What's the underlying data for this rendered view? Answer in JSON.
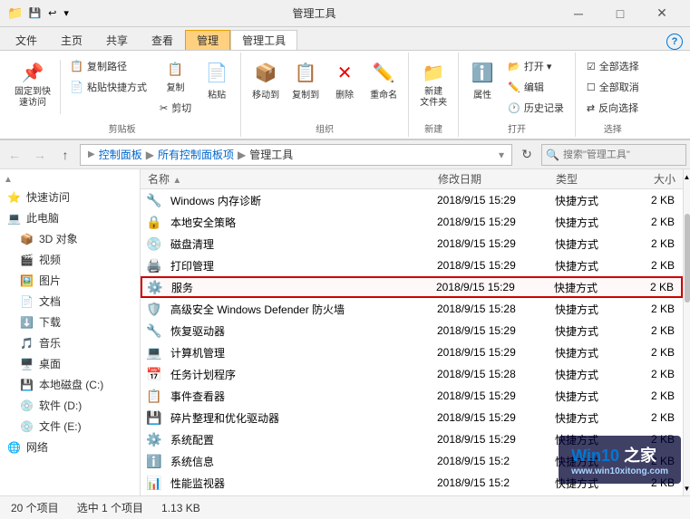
{
  "titlebar": {
    "title": "管理工具",
    "icon": "📁",
    "min_label": "─",
    "max_label": "□",
    "close_label": "✕"
  },
  "ribbon_tabs": [
    {
      "id": "file",
      "label": "文件"
    },
    {
      "id": "home",
      "label": "主页"
    },
    {
      "id": "share",
      "label": "共享"
    },
    {
      "id": "view",
      "label": "查看"
    },
    {
      "id": "manage",
      "label": "管理",
      "highlighted": true
    },
    {
      "id": "manage_tools",
      "label": "管理工具"
    }
  ],
  "ribbon": {
    "groups": [
      {
        "id": "clipboard",
        "label": "剪贴板",
        "buttons": [
          {
            "id": "pin",
            "icon": "📌",
            "label": "固定到快\n速访问"
          },
          {
            "id": "copy",
            "icon": "📋",
            "label": "复制"
          },
          {
            "id": "paste",
            "icon": "📄",
            "label": "粘贴"
          }
        ],
        "sub_buttons": [
          {
            "id": "copy_path",
            "icon": "📋",
            "label": "复制路径"
          },
          {
            "id": "paste_shortcut",
            "icon": "📄",
            "label": "粘贴快捷方式"
          },
          {
            "id": "cut",
            "icon": "✂️",
            "label": "剪切"
          }
        ]
      },
      {
        "id": "organize",
        "label": "组织",
        "buttons": [
          {
            "id": "move_to",
            "icon": "📦",
            "label": "移动到"
          },
          {
            "id": "copy_to",
            "icon": "📋",
            "label": "复制到"
          },
          {
            "id": "delete",
            "icon": "❌",
            "label": "删除"
          },
          {
            "id": "rename",
            "icon": "✏️",
            "label": "重命名"
          }
        ]
      },
      {
        "id": "new",
        "label": "新建",
        "buttons": [
          {
            "id": "new_folder",
            "icon": "📁",
            "label": "新建\n文件夹"
          }
        ]
      },
      {
        "id": "open",
        "label": "打开",
        "buttons": [
          {
            "id": "properties",
            "icon": "ℹ️",
            "label": "属性"
          }
        ],
        "sub_buttons": [
          {
            "id": "open",
            "icon": "📂",
            "label": "打开▾"
          },
          {
            "id": "edit",
            "icon": "✏️",
            "label": "编辑"
          },
          {
            "id": "history",
            "icon": "🕐",
            "label": "历史记录"
          }
        ]
      },
      {
        "id": "select",
        "label": "选择",
        "sub_buttons": [
          {
            "id": "select_all",
            "icon": "☑",
            "label": "全部选择"
          },
          {
            "id": "select_none",
            "icon": "☐",
            "label": "全部取消"
          },
          {
            "id": "invert",
            "icon": "⇄",
            "label": "反向选择"
          }
        ]
      }
    ]
  },
  "addressbar": {
    "back_label": "←",
    "forward_label": "→",
    "up_label": "↑",
    "path": [
      "控制面板",
      "所有控制面板项",
      "管理工具"
    ],
    "refresh_label": "↻",
    "search_placeholder": "搜索\"管理工具\""
  },
  "sidebar": {
    "sections": [
      {
        "id": "quick_access",
        "label": "快速访问",
        "icon": "⭐",
        "expanded": true
      },
      {
        "id": "this_pc",
        "label": "此电脑",
        "icon": "💻",
        "expanded": true
      },
      {
        "id": "3d_objects",
        "label": "3D 对象",
        "icon": "📦",
        "indent": 1
      },
      {
        "id": "videos",
        "label": "视频",
        "icon": "🎬",
        "indent": 1
      },
      {
        "id": "pictures",
        "label": "图片",
        "icon": "🖼️",
        "indent": 1
      },
      {
        "id": "documents",
        "label": "文档",
        "icon": "📄",
        "indent": 1
      },
      {
        "id": "downloads",
        "label": "下载",
        "icon": "⬇️",
        "indent": 1
      },
      {
        "id": "music",
        "label": "音乐",
        "icon": "🎵",
        "indent": 1
      },
      {
        "id": "desktop",
        "label": "桌面",
        "icon": "🖥️",
        "indent": 1
      },
      {
        "id": "local_c",
        "label": "本地磁盘 (C:)",
        "icon": "💾",
        "indent": 1
      },
      {
        "id": "soft_d",
        "label": "软件 (D:)",
        "icon": "💿",
        "indent": 1
      },
      {
        "id": "file_e",
        "label": "文件 (E:)",
        "icon": "💿",
        "indent": 1
      },
      {
        "id": "network",
        "label": "网络",
        "icon": "🌐"
      }
    ]
  },
  "filelist": {
    "headers": [
      {
        "id": "name",
        "label": "名称",
        "sort": "▲"
      },
      {
        "id": "date",
        "label": "修改日期"
      },
      {
        "id": "type",
        "label": "类型"
      },
      {
        "id": "size",
        "label": "大小"
      }
    ],
    "files": [
      {
        "id": 1,
        "icon": "🔧",
        "name": "Windows 内存诊断",
        "date": "2018/9/15 15:29",
        "type": "快捷方式",
        "size": "2 KB",
        "selected": false,
        "highlighted": false
      },
      {
        "id": 2,
        "icon": "🔒",
        "name": "本地安全策略",
        "date": "2018/9/15 15:29",
        "type": "快捷方式",
        "size": "2 KB",
        "selected": false,
        "highlighted": false
      },
      {
        "id": 3,
        "icon": "💿",
        "name": "磁盘清理",
        "date": "2018/9/15 15:29",
        "type": "快捷方式",
        "size": "2 KB",
        "selected": false,
        "highlighted": false
      },
      {
        "id": 4,
        "icon": "🖨️",
        "name": "打印管理",
        "date": "2018/9/15 15:29",
        "type": "快捷方式",
        "size": "2 KB",
        "selected": false,
        "highlighted": false
      },
      {
        "id": 5,
        "icon": "⚙️",
        "name": "服务",
        "date": "2018/9/15 15:29",
        "type": "快捷方式",
        "size": "2 KB",
        "selected": true,
        "highlighted": true
      },
      {
        "id": 6,
        "icon": "🛡️",
        "name": "高级安全 Windows Defender 防火墙",
        "date": "2018/9/15 15:28",
        "type": "快捷方式",
        "size": "2 KB",
        "selected": false,
        "highlighted": false
      },
      {
        "id": 7,
        "icon": "🔧",
        "name": "恢复驱动器",
        "date": "2018/9/15 15:29",
        "type": "快捷方式",
        "size": "2 KB",
        "selected": false,
        "highlighted": false
      },
      {
        "id": 8,
        "icon": "💻",
        "name": "计算机管理",
        "date": "2018/9/15 15:29",
        "type": "快捷方式",
        "size": "2 KB",
        "selected": false,
        "highlighted": false
      },
      {
        "id": 9,
        "icon": "📅",
        "name": "任务计划程序",
        "date": "2018/9/15 15:28",
        "type": "快捷方式",
        "size": "2 KB",
        "selected": false,
        "highlighted": false
      },
      {
        "id": 10,
        "icon": "📋",
        "name": "事件查看器",
        "date": "2018/9/15 15:29",
        "type": "快捷方式",
        "size": "2 KB",
        "selected": false,
        "highlighted": false
      },
      {
        "id": 11,
        "icon": "💾",
        "name": "碎片整理和优化驱动器",
        "date": "2018/9/15 15:29",
        "type": "快捷方式",
        "size": "2 KB",
        "selected": false,
        "highlighted": false
      },
      {
        "id": 12,
        "icon": "⚙️",
        "name": "系统配置",
        "date": "2018/9/15 15:29",
        "type": "快捷方式",
        "size": "2 KB",
        "selected": false,
        "highlighted": false
      },
      {
        "id": 13,
        "icon": "ℹ️",
        "name": "系统信息",
        "date": "2018/9/15 15:2",
        "type": "快捷方式",
        "size": "2 KB",
        "selected": false,
        "highlighted": false
      },
      {
        "id": 14,
        "icon": "📊",
        "name": "性能监视器",
        "date": "2018/9/15 15:2",
        "type": "快捷方式",
        "size": "2 KB",
        "selected": false,
        "highlighted": false
      }
    ]
  },
  "statusbar": {
    "total": "20 个项目",
    "selected": "选中 1 个项目",
    "size": "1.13 KB"
  },
  "watermark": {
    "line1": "Win10 之家",
    "line2": "www.win10xitong.com"
  }
}
